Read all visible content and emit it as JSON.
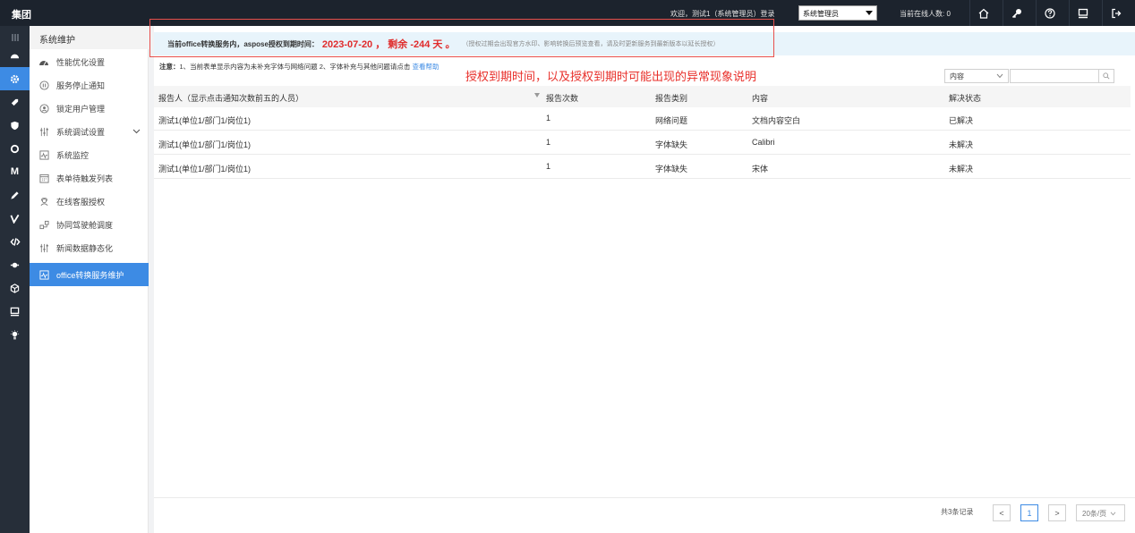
{
  "topbar": {
    "brand": "集团",
    "welcome": "欢迎，测试1（系统管理员）登录",
    "role_value": "系统管理员",
    "online": "当前在线人数: 0",
    "icons": [
      "home-icon",
      "key-icon",
      "help-icon",
      "monitor-icon",
      "logout-icon"
    ]
  },
  "rail": {
    "icons": [
      "menu-icon",
      "dashboard-icon",
      "settings-gear-icon",
      "tag-icon",
      "shield-icon",
      "gear-icon",
      "m-icon",
      "edit-icon",
      "check-icon",
      "code-icon",
      "plug-icon",
      "cube-icon",
      "monitor-icon",
      "bulb-icon"
    ]
  },
  "sidebar": {
    "title": "系统维护",
    "items": [
      {
        "label": "性能优化设置",
        "icon": "gauge-icon"
      },
      {
        "label": "服务停止通知",
        "icon": "pause-icon"
      },
      {
        "label": "锁定用户管理",
        "icon": "user-lock-icon"
      },
      {
        "label": "系统调试设置",
        "icon": "sliders-icon"
      },
      {
        "label": "系统监控",
        "icon": "pulse-icon"
      },
      {
        "label": "表单待触发列表",
        "icon": "calendar-icon"
      },
      {
        "label": "在线客服授权",
        "icon": "support-icon"
      },
      {
        "label": "协同驾驶舱调度",
        "icon": "share-icon"
      },
      {
        "label": "新闻数据静态化",
        "icon": "sliders-icon"
      },
      {
        "label": "office转换服务维护",
        "icon": "pulse-icon"
      }
    ]
  },
  "banner": {
    "text": "当前office转换服务内，aspose授权到期时间：",
    "date": "2023-07-20 ， 剩余 -244 天 。",
    "hint": "（授权过期会出现官方水印、影响转换后预览查看，请及时更新服务到最新版本以延长授权）"
  },
  "notice": {
    "label": "注意：",
    "text": "1、当前表单显示内容为未补充字体与网络问题 2、字体补充与其他问题请点击",
    "link": "查看帮助"
  },
  "annotation": "授权到期时间，以及授权到期时可能出现的异常现象说明",
  "search": {
    "field_value": "内容",
    "placeholder": ""
  },
  "table": {
    "headers": [
      "报告人（显示点击通知次数前五的人员）",
      "报告次数",
      "报告类别",
      "内容",
      "解决状态"
    ],
    "rows": [
      [
        "测试1(单位1/部门1/岗位1)",
        "1",
        "网络问题",
        "文档内容空白",
        "已解决"
      ],
      [
        "测试1(单位1/部门1/岗位1)",
        "1",
        "字体缺失",
        "Calibri",
        "未解决"
      ],
      [
        "测试1(单位1/部门1/岗位1)",
        "1",
        "字体缺失",
        "宋体",
        "未解决"
      ]
    ]
  },
  "pagination": {
    "total": "共3条记录",
    "prev": "<",
    "current": "1",
    "next": ">",
    "page_size": "20条/页"
  },
  "colors": {
    "accent": "#3d8be4",
    "topbar": "#1c232d",
    "rail": "#262e39",
    "alert": "#e02b2b"
  }
}
